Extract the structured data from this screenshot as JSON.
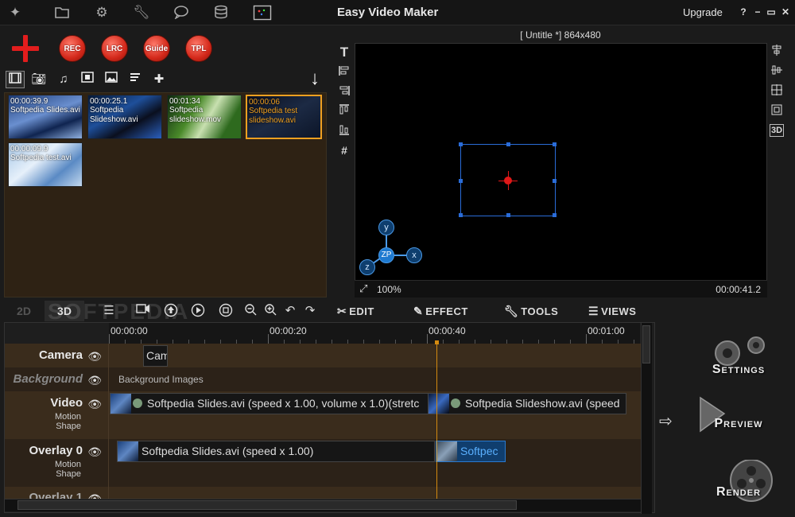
{
  "window": {
    "title": "Easy Video Maker",
    "upgrade_label": "Upgrade",
    "controls": [
      "?",
      "−",
      "▭",
      "✕"
    ]
  },
  "toolbar_icons": [
    "magic-wand-icon",
    "folder-icon",
    "gear-icon",
    "wrench-icon",
    "chat-icon",
    "database-icon",
    "screen-capture-icon"
  ],
  "record_buttons": {
    "rec": "REC",
    "lrc": "LRC",
    "guide": "Guide",
    "tpl": "TPL"
  },
  "media_tabs": [
    "video",
    "photo",
    "music",
    "film",
    "image",
    "text",
    "puzzle"
  ],
  "media_items": [
    {
      "time": "00:00:39.9",
      "name": "Softpedia Slides.avi",
      "selected": false
    },
    {
      "time": "00:00:25.1",
      "name": "Softpedia Slideshow.avi",
      "selected": false
    },
    {
      "time": "00:01:34",
      "name": "Softpedia slideshow.mov",
      "selected": false
    },
    {
      "time": "00:00:06",
      "name": "Softpedia test slideshow.avi",
      "selected": true
    },
    {
      "time": "00:00:09.9",
      "name": "Softpedia test.avi",
      "selected": false
    }
  ],
  "canvas": {
    "header": "[ Untitle *]  864x480",
    "zoom": "100%",
    "time": "00:00:41.2",
    "axes": {
      "y": "y",
      "x": "x",
      "z": "z",
      "zp": "ZP"
    }
  },
  "timeline_toolbar": {
    "mode_2d": "2D",
    "mode_3d": "3D",
    "watermark": "SOFTPEDIA",
    "edit": "EDIT",
    "effect": "EFFECT",
    "tools": "TOOLS",
    "views": "VIEWS"
  },
  "ruler": {
    "ticks": [
      "00:00:00",
      "00:00:20",
      "00:00:40",
      "00:01:00"
    ]
  },
  "tracks": {
    "camera": {
      "name": "Camera",
      "clip": "Cam"
    },
    "background": {
      "name": "Background",
      "clip": "Background Images"
    },
    "video": {
      "name": "Video",
      "sub1": "Motion",
      "sub2": "Shape",
      "clip1": "Softpedia Slides.avi  (speed x 1.00, volume x 1.0)(stretc",
      "clip2": "Softpedia Slideshow.avi  (speed"
    },
    "overlay0": {
      "name": "Overlay 0",
      "sub1": "Motion",
      "sub2": "Shape",
      "clip1": "Softpedia Slides.avi  (speed x 1.00)",
      "clip2": "Softpec"
    },
    "overlay1": {
      "name": "Overlay 1"
    }
  },
  "actions": {
    "settings": "Settings",
    "preview": "Preview",
    "render": "Render"
  },
  "colors": {
    "accent_red": "#e21d1d",
    "selection_blue": "#2a6cd8",
    "playhead_orange": "#d48a10",
    "media_bg": "#2e2214"
  }
}
